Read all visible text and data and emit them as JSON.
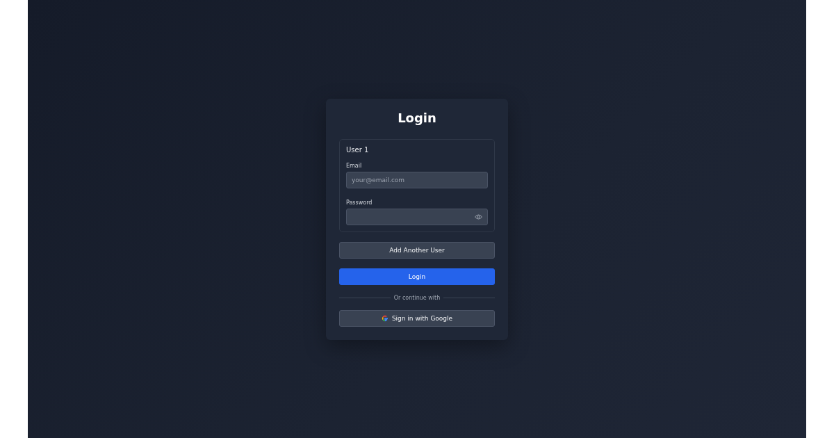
{
  "title": "Login",
  "users": [
    {
      "heading": "User 1",
      "email": {
        "label": "Email",
        "placeholder": "your@email.com"
      },
      "password": {
        "label": "Password"
      }
    }
  ],
  "add_user_button": "Add Another User",
  "login_button": "Login",
  "divider_text": "Or continue with",
  "google_button": "Sign in with Google"
}
